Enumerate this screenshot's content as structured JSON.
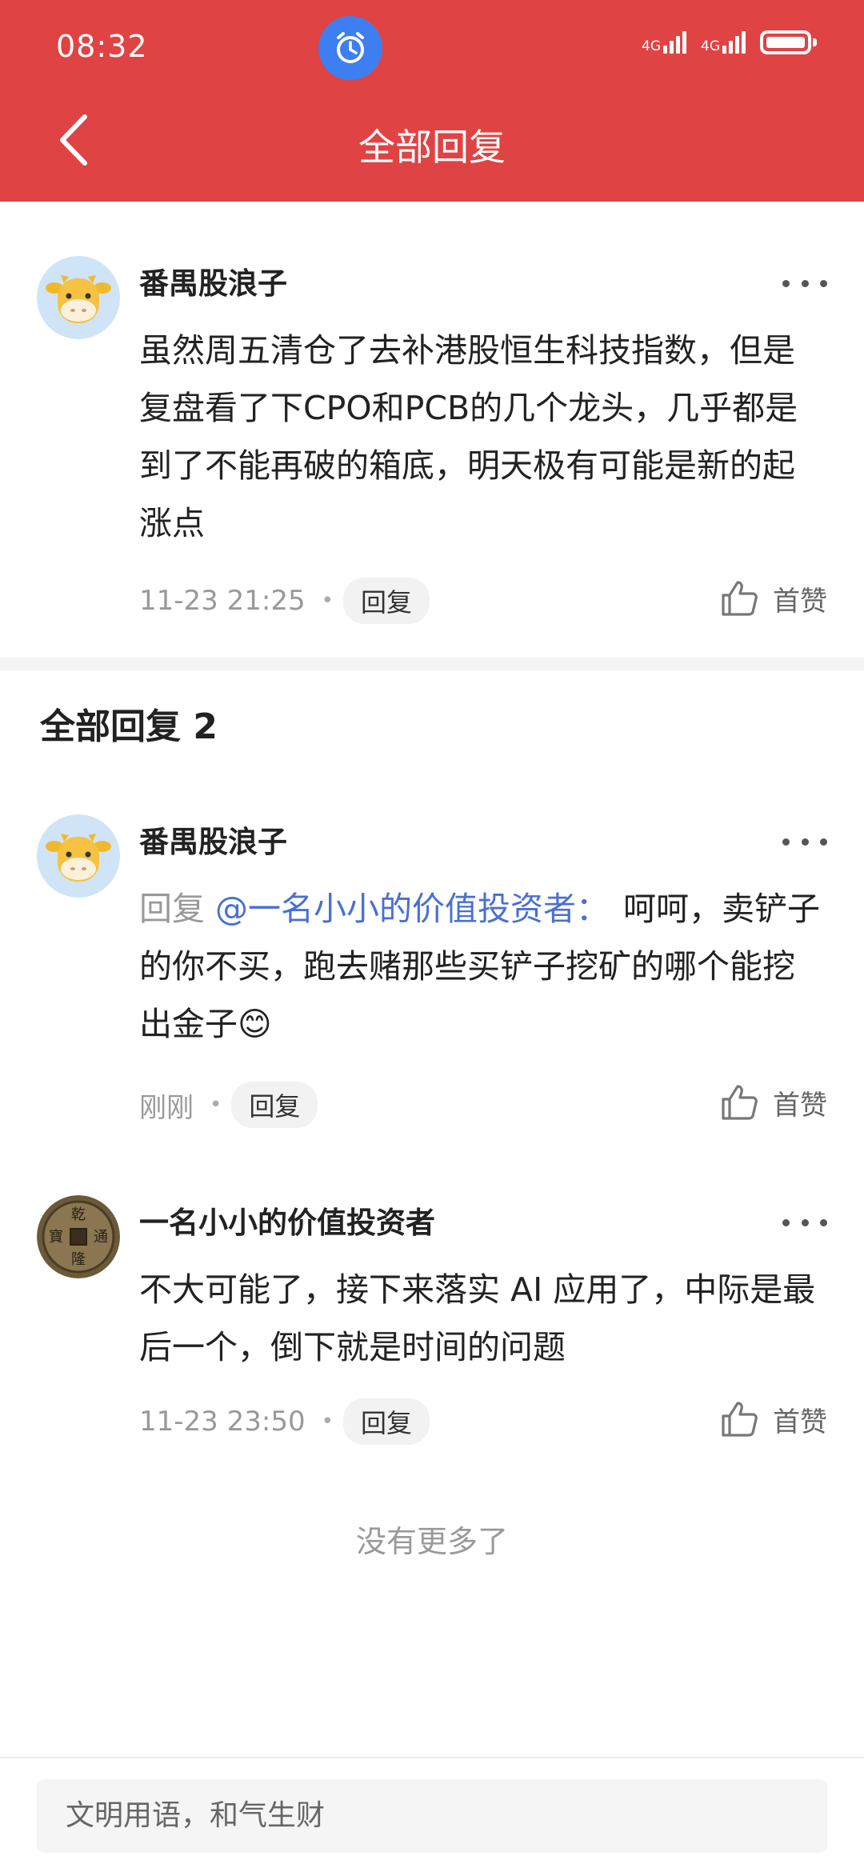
{
  "status_bar": {
    "time": "08:32",
    "net1": "4G",
    "net2": "4G"
  },
  "header": {
    "title": "全部回复"
  },
  "main_comment": {
    "username": "番禺股浪子",
    "text": "虽然周五清仓了去补港股恒生科技指数，但是复盘看了下CPO和PCB的几个龙头，几乎都是到了不能再破的箱底，明天极有可能是新的起涨点",
    "time": "11-23 21:25",
    "reply_label": "回复",
    "like_label": "首赞"
  },
  "replies_section": {
    "title": "全部回复 2"
  },
  "replies": [
    {
      "username": "番禺股浪子",
      "reply_prefix": "回复",
      "mention": "@一名小小的价值投资者：",
      "text": "呵呵，卖铲子的你不买，跑去赌那些买铲子挖矿的哪个能挖出金子",
      "emoji": "😊",
      "time": "刚刚",
      "reply_label": "回复",
      "like_label": "首赞"
    },
    {
      "username": "一名小小的价值投资者",
      "text": "不大可能了，接下来落实 AI 应用了，中际是最后一个，倒下就是时间的问题",
      "time": "11-23 23:50",
      "reply_label": "回复",
      "like_label": "首赞",
      "avatar_coin_text": "乾隆通寶"
    }
  ],
  "no_more": "没有更多了",
  "input": {
    "placeholder": "文明用语，和气生财"
  },
  "colors": {
    "header_bg": "#e04343",
    "mention": "#4a6fd4",
    "alarm_bg": "#3d7ff0"
  }
}
